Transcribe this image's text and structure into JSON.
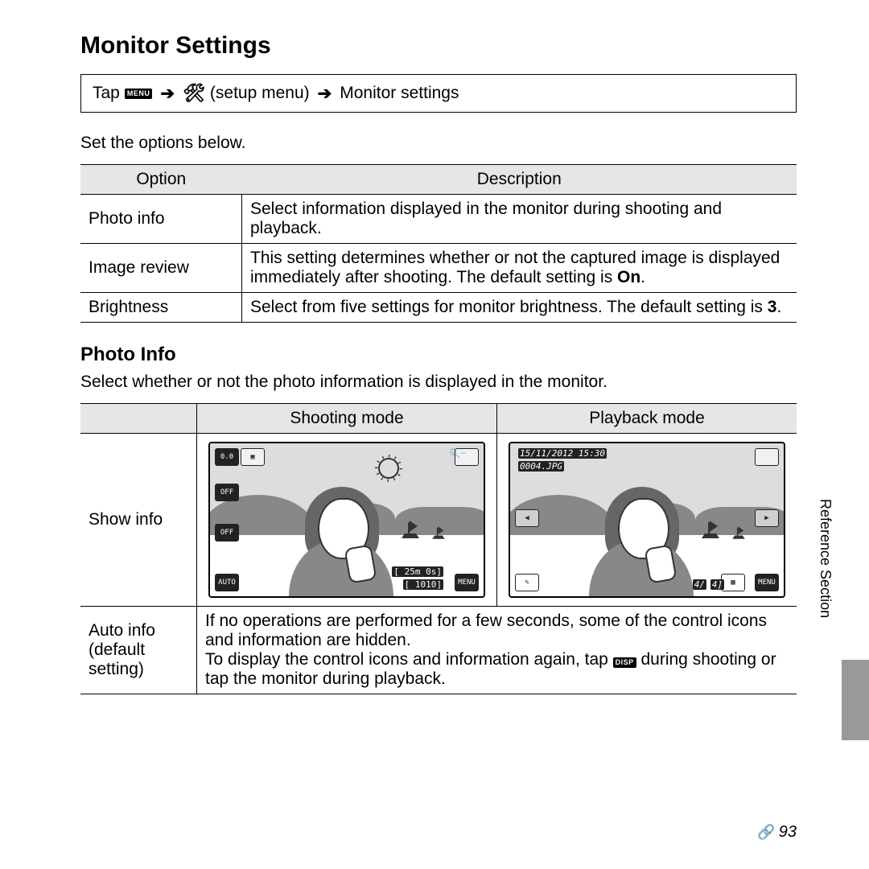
{
  "title": "Monitor Settings",
  "nav": {
    "prefix": "Tap",
    "menu_icon_label": "MENU",
    "setup_text": "(setup menu)",
    "target": "Monitor settings"
  },
  "intro": "Set the options below.",
  "options_table": {
    "headers": [
      "Option",
      "Description"
    ],
    "rows": [
      {
        "option": "Photo info",
        "desc": "Select information displayed in the monitor during shooting and playback."
      },
      {
        "option": "Image review",
        "desc_pre": "This setting determines whether or not the captured image is displayed immediately after shooting. The default setting is ",
        "desc_bold": "On",
        "desc_post": "."
      },
      {
        "option": "Brightness",
        "desc_pre": "Select from five settings for monitor brightness. The default setting is ",
        "desc_bold": "3",
        "desc_post": "."
      }
    ]
  },
  "photo_info": {
    "heading": "Photo Info",
    "sub": "Select whether or not the photo information is displayed in the monitor.",
    "cols": [
      "Shooting mode",
      "Playback mode"
    ],
    "row1_label": "Show info",
    "row2_label_a": "Auto info",
    "row2_label_b": "(default setting)",
    "row2_desc_a": "If no operations are performed for a few seconds, some of the control icons and information are hidden.",
    "row2_desc_b_pre": "To display the control icons and information again, tap ",
    "row2_desc_b_post": " during shooting or tap the monitor during playback.",
    "disp_icon_label": "DISP"
  },
  "lcd": {
    "shoot": {
      "ev_icon": "0.0",
      "flash_off": "OFF",
      "timer_off": "OFF",
      "auto": "AUTO",
      "time_remaining": "[ 25m 0s]",
      "shots_remaining": "[ 1010]",
      "menu": "MENU"
    },
    "play": {
      "date": "15/11/2012 15:30",
      "file": "0004.JPG",
      "count": "4/",
      "total": "4]",
      "menu": "MENU"
    }
  },
  "side_label": "Reference Section",
  "page_number": "93"
}
